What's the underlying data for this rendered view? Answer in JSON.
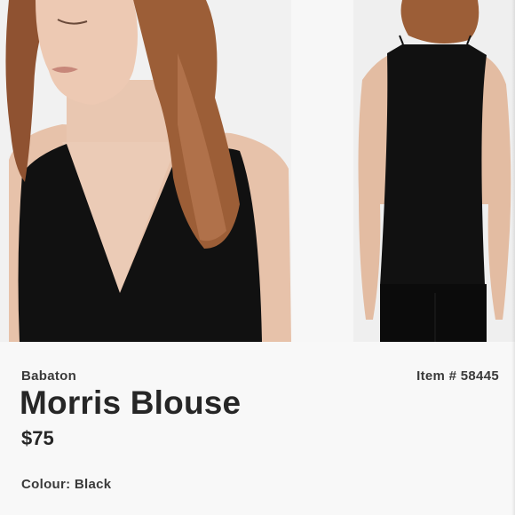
{
  "listing": {
    "brand": "Babaton",
    "item_number": "Item # 58445",
    "product_name": "Morris Blouse",
    "price": "$75",
    "colour": "Colour: Black"
  },
  "photos": [
    {
      "view": "front",
      "icon": "model-front-photo"
    },
    {
      "view": "back",
      "icon": "model-back-photo"
    }
  ],
  "colors": {
    "garment": "#111111",
    "skin": "#e6bfa6",
    "hair": "#9a5a35",
    "background": "#f7f7f7",
    "text_primary": "#262626"
  }
}
